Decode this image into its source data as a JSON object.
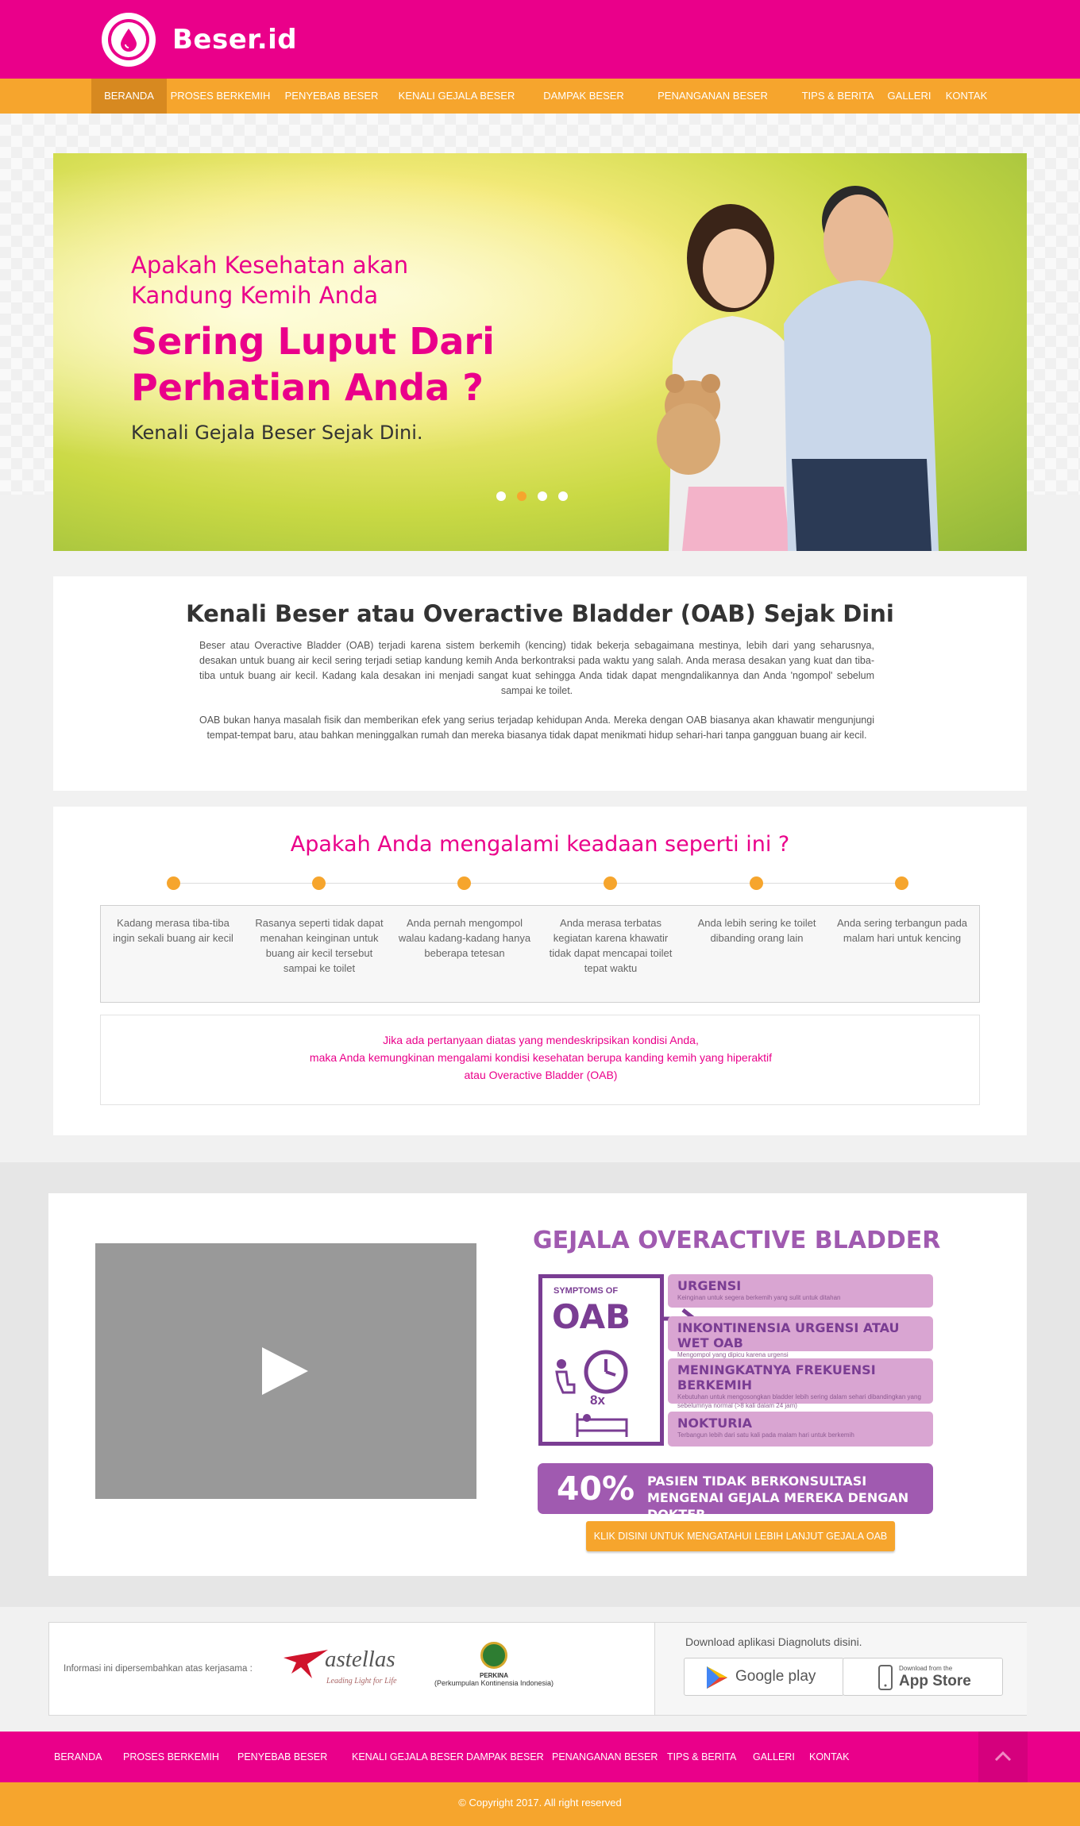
{
  "brand": {
    "name": "Beser.id",
    "logo_icon": "droplet-icon"
  },
  "nav": {
    "items": [
      "BERANDA",
      "PROSES BERKEMIH",
      "PENYEBAB BESER",
      "KENALI GEJALA BESER",
      "DAMPAK BESER",
      "PENANGANAN BESER",
      "TIPS & BERITA",
      "GALLERI",
      "KONTAK"
    ],
    "active": "BERANDA"
  },
  "hero": {
    "line1": "Apakah Kesehatan akan Kandung Kemih Anda",
    "line2": "Sering Luput Dari Perhatian Anda ?",
    "line3": "Kenali Gejala Beser Sejak Dini.",
    "slides_total": 4,
    "slide_active": 2
  },
  "intro": {
    "title": "Kenali Beser atau Overactive Bladder (OAB) Sejak Dini",
    "p1": "Beser atau Overactive Bladder (OAB) terjadi karena sistem berkemih (kencing) tidak bekerja sebagaimana mestinya, lebih dari yang seharusnya, desakan untuk buang air kecil sering terjadi setiap kandung kemih Anda berkontraksi pada waktu yang salah. Anda merasa desakan yang kuat dan tiba-tiba untuk buang air kecil. Kadang kala desakan ini menjadi sangat kuat sehingga Anda tidak dapat mengndalikannya dan Anda 'ngompol' sebelum sampai ke toilet.",
    "p2": "OAB bukan hanya masalah fisik dan memberikan efek yang serius terjadap kehidupan Anda. Mereka dengan OAB biasanya akan khawatir mengunjungi tempat-tempat baru, atau bahkan meninggalkan rumah dan mereka biasanya tidak dapat menikmati hidup sehari-hari tanpa gangguan buang air kecil."
  },
  "question": {
    "title": "Apakah Anda mengalami keadaan seperti ini ?",
    "symptoms": [
      "Kadang merasa  tiba-tiba ingin sekali buang air kecil",
      "Rasanya seperti tidak dapat menahan keinginan untuk buang air kecil tersebut sampai ke toilet",
      "Anda pernah  mengompol walau kadang-kadang hanya beberapa tetesan",
      "Anda merasa terbatas kegiatan karena khawatir tidak dapat mencapai toilet tepat waktu",
      "Anda lebih sering ke toilet dibanding orang lain",
      "Anda sering terbangun pada malam hari untuk kencing"
    ],
    "notice": [
      "Jika ada pertanyaan diatas yang mendeskripsikan kondisi Anda,",
      "maka Anda kemungkinan mengalami kondisi kesehatan berupa kanding kemih yang hiperaktif",
      "atau Overactive Bladder (OAB)"
    ]
  },
  "infographic": {
    "title": "GEJALA OVERACTIVE BLADDER",
    "box_label": "SYMPTOMS OF",
    "box_big": "OAB",
    "box_count": "8x",
    "items": [
      {
        "title": "URGENSI",
        "desc": "Keinginan untuk segera berkemih yang sulit untuk ditahan"
      },
      {
        "title": "INKONTINENSIA URGENSI ATAU WET OAB",
        "desc": "Mengompol yang dipicu karena urgensi"
      },
      {
        "title": "MENINGKATNYA FREKUENSI BERKEMIH",
        "desc": "Kebutuhan untuk mengosongkan bladder lebih sering dalam sehari dibandingkan yang sebelumnya normal (>8 kali dalam 24 jam)"
      },
      {
        "title": "NOKTURIA",
        "desc": "Terbangun lebih dari satu kali pada malam hari untuk berkemih"
      }
    ],
    "stat_pct": "40%",
    "stat_text": "PASIEN TIDAK BERKONSULTASI MENGENAI GEJALA MEREKA DENGAN DOKTER",
    "cta": "KLIK DISINI UNTUK MENGATAHUI LEBIH LANJUT GEJALA OAB"
  },
  "partners": {
    "label": "Informasi ini dipersembahkan atas kerjasama :",
    "astellas_name": "astellas",
    "astellas_tag": "Leading Light for Life",
    "perkina_name": "PERKINA",
    "perkina_full": "(Perkumpulan Kontinensia Indonesia)",
    "download_label": "Download aplikasi Diagnoluts disini.",
    "google_play": "Google play",
    "app_store_small": "Download from the",
    "app_store": "App Store"
  },
  "footer": {
    "items": [
      "BERANDA",
      "PROSES BERKEMIH",
      "PENYEBAB BESER",
      "KENALI GEJALA BESER",
      "DAMPAK BESER",
      "PENANGANAN BESER",
      "TIPS & BERITA",
      "GALLERI",
      "KONTAK"
    ],
    "copyright": "© Copyright 2017. All right reserved"
  },
  "colors": {
    "primary": "#ea008a",
    "accent": "#f6a52d",
    "purple": "#a05ab0"
  }
}
